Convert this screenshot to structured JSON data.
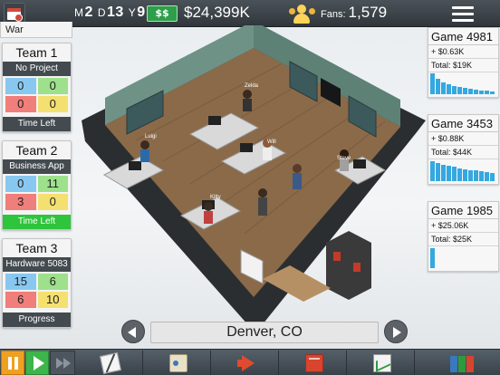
{
  "topbar": {
    "date": {
      "month_prefix": "M",
      "month": "2",
      "day_prefix": "D",
      "day": "13",
      "year_prefix": "Y",
      "year": "9"
    },
    "money_icon_label": "$$",
    "money": "$24,399K",
    "fans_label": "Fans:",
    "fans": "1,579",
    "icons": {
      "calendar": "calendar-icon",
      "money": "money-icon",
      "fans": "fans-icon",
      "menu": "hamburger-menu-icon"
    }
  },
  "left_panel": {
    "header": "War",
    "teams": [
      {
        "name": "Team 1",
        "project": "No Project",
        "stats": [
          "0",
          "0",
          "0",
          "0"
        ],
        "footer": "Time Left",
        "footer_active": false
      },
      {
        "name": "Team 2",
        "project": "Business App",
        "stats": [
          "0",
          "11",
          "3",
          "0"
        ],
        "footer": "Time Left",
        "footer_active": true
      },
      {
        "name": "Team 3",
        "project": "Hardware 5083",
        "stats": [
          "15",
          "6",
          "6",
          "10"
        ],
        "footer": "Progress",
        "footer_active": false
      }
    ]
  },
  "games": [
    {
      "title": "Game 4981",
      "income": "+ $0.63K",
      "total": "Total: $19K",
      "trend": [
        0.95,
        0.7,
        0.55,
        0.45,
        0.38,
        0.32,
        0.28,
        0.24,
        0.2,
        0.18,
        0.16,
        0.14
      ]
    },
    {
      "title": "Game 3453",
      "income": "+ $0.88K",
      "total": "Total: $44K",
      "trend": [
        0.9,
        0.85,
        0.75,
        0.7,
        0.65,
        0.6,
        0.56,
        0.52,
        0.48,
        0.44,
        0.4,
        0.38
      ]
    },
    {
      "title": "Game 1985",
      "income": "+ $25.06K",
      "total": "Total: $25K",
      "trend": [
        0.92
      ]
    }
  ],
  "scene": {
    "characters": [
      "Zelda",
      "Luigi",
      "Will",
      "Steve",
      "Kitty"
    ]
  },
  "location": {
    "name": "Denver, CO",
    "prev_icon": "arrow-left-icon",
    "next_icon": "arrow-right-icon"
  },
  "toolbar": {
    "icons": [
      "pause-icon",
      "play-icon",
      "fast-forward-icon",
      "design-icon",
      "staff-icon",
      "marketing-icon",
      "book-icon",
      "stats-icon",
      "files-icon"
    ]
  }
}
